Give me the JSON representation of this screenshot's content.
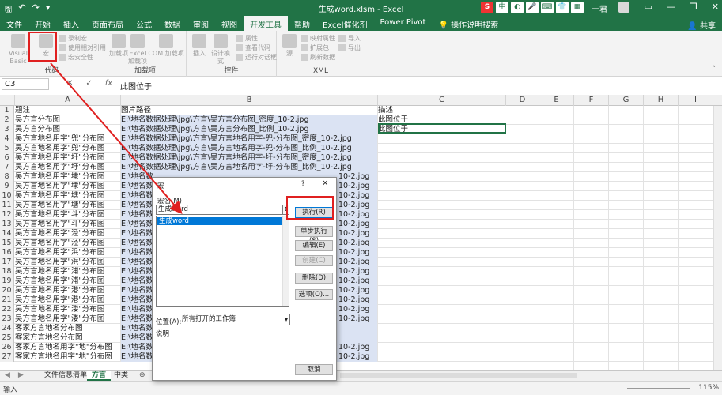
{
  "window": {
    "title": "生成word.xlsm - Excel",
    "user": "一君",
    "brand_letter": "S"
  },
  "ribbon_tabs": [
    {
      "label": "文件",
      "active": false
    },
    {
      "label": "开始",
      "active": false
    },
    {
      "label": "插入",
      "active": false
    },
    {
      "label": "页面布局",
      "active": false
    },
    {
      "label": "公式",
      "active": false
    },
    {
      "label": "数据",
      "active": false
    },
    {
      "label": "审阅",
      "active": false
    },
    {
      "label": "视图",
      "active": false
    },
    {
      "label": "开发工具",
      "active": true
    },
    {
      "label": "帮助",
      "active": false
    },
    {
      "label": "Excel催化剂",
      "active": false
    },
    {
      "label": "Power Pivot",
      "active": false
    },
    {
      "label": "操作说明搜索",
      "active": false
    }
  ],
  "share_label": "共享",
  "ribbon": {
    "code": {
      "label": "代码",
      "visual_basic": "Visual Basic",
      "macro": "宏",
      "record_macro": "录制宏",
      "relative_ref": "使用相对引用",
      "macro_security": "宏安全性"
    },
    "addins": {
      "label": "加载项",
      "addin": "加载项",
      "excel_addin": "Excel 加载项",
      "com_addin": "COM 加载项"
    },
    "controls": {
      "label": "控件",
      "insert": "插入",
      "design_mode": "设计模式",
      "properties": "属性",
      "view_code": "查看代码",
      "run_dialog": "运行对话框"
    },
    "xml": {
      "label": "XML",
      "source": "源",
      "map_props": "映射属性",
      "expansion": "扩展包",
      "refresh": "刷新数据",
      "import": "导入",
      "export": "导出"
    }
  },
  "formula_bar": {
    "name_box": "C3",
    "value": "此图位于"
  },
  "columns": [
    "A",
    "B",
    "C",
    "D",
    "E",
    "F",
    "G",
    "H",
    "I"
  ],
  "rows": [
    {
      "num": "1",
      "a": "题注",
      "b": "图片路径",
      "c": "描述"
    },
    {
      "num": "2",
      "a": "吴方言分布图",
      "b": "E:\\地名数据处理\\jpg\\方言\\吴方言分布图_密度_10-2.jpg",
      "c": "此图位于"
    },
    {
      "num": "3",
      "a": "吴方言分布图",
      "b": "E:\\地名数据处理\\jpg\\方言\\吴方言分布图_比例_10-2.jpg",
      "c": "此图位于"
    },
    {
      "num": "4",
      "a": "吴方言地名用字\"兜\"分布图",
      "b": "E:\\地名数据处理\\jpg\\方言\\吴方言地名用字-兜-分布图_密度_10-2.jpg",
      "c": ""
    },
    {
      "num": "5",
      "a": "吴方言地名用字\"兜\"分布图",
      "b": "E:\\地名数据处理\\jpg\\方言\\吴方言地名用字-兜-分布图_比例_10-2.jpg",
      "c": ""
    },
    {
      "num": "6",
      "a": "吴方言地名用字\"圩\"分布图",
      "b": "E:\\地名数据处理\\jpg\\方言\\吴方言地名用字-圩-分布图_密度_10-2.jpg",
      "c": ""
    },
    {
      "num": "7",
      "a": "吴方言地名用字\"圩\"分布图",
      "b": "E:\\地名数据处理\\jpg\\方言\\吴方言地名用字-圩-分布图_比例_10-2.jpg",
      "c": ""
    },
    {
      "num": "8",
      "a": "吴方言地名用字\"埭\"分布图",
      "b": "E:\\地名数",
      "b_tail": "10-2.jpg",
      "c": ""
    },
    {
      "num": "9",
      "a": "吴方言地名用字\"埭\"分布图",
      "b": "E:\\地名数",
      "b_tail": "10-2.jpg",
      "c": ""
    },
    {
      "num": "10",
      "a": "吴方言地名用字\"塘\"分布图",
      "b": "E:\\地名数",
      "b_tail": "10-2.jpg",
      "c": ""
    },
    {
      "num": "11",
      "a": "吴方言地名用字\"塘\"分布图",
      "b": "E:\\地名数",
      "b_tail": "10-2.jpg",
      "c": ""
    },
    {
      "num": "12",
      "a": "吴方言地名用字\"斗\"分布图",
      "b": "E:\\地名数",
      "b_tail": "10-2.jpg",
      "c": ""
    },
    {
      "num": "13",
      "a": "吴方言地名用字\"斗\"分布图",
      "b": "E:\\地名数",
      "b_tail": "10-2.jpg",
      "c": ""
    },
    {
      "num": "14",
      "a": "吴方言地名用字\"泾\"分布图",
      "b": "E:\\地名数",
      "b_tail": "10-2.jpg",
      "c": ""
    },
    {
      "num": "15",
      "a": "吴方言地名用字\"泾\"分布图",
      "b": "E:\\地名数",
      "b_tail": "10-2.jpg",
      "c": ""
    },
    {
      "num": "16",
      "a": "吴方言地名用字\"浜\"分布图",
      "b": "E:\\地名数",
      "b_tail": "10-2.jpg",
      "c": ""
    },
    {
      "num": "17",
      "a": "吴方言地名用字\"浜\"分布图",
      "b": "E:\\地名数",
      "b_tail": "10-2.jpg",
      "c": ""
    },
    {
      "num": "18",
      "a": "吴方言地名用字\"浦\"分布图",
      "b": "E:\\地名数",
      "b_tail": "10-2.jpg",
      "c": ""
    },
    {
      "num": "19",
      "a": "吴方言地名用字\"浦\"分布图",
      "b": "E:\\地名数",
      "b_tail": "10-2.jpg",
      "c": ""
    },
    {
      "num": "20",
      "a": "吴方言地名用字\"港\"分布图",
      "b": "E:\\地名数",
      "b_tail": "10-2.jpg",
      "c": ""
    },
    {
      "num": "21",
      "a": "吴方言地名用字\"港\"分布图",
      "b": "E:\\地名数",
      "b_tail": "10-2.jpg",
      "c": ""
    },
    {
      "num": "22",
      "a": "吴方言地名用字\"溇\"分布图",
      "b": "E:\\地名数",
      "b_tail": "10-2.jpg",
      "c": ""
    },
    {
      "num": "23",
      "a": "吴方言地名用字\"溇\"分布图",
      "b": "E:\\地名数",
      "b_tail": "10-2.jpg",
      "c": ""
    },
    {
      "num": "24",
      "a": "客家方言地名分布图",
      "b": "E:\\地名数",
      "b_tail": "",
      "c": ""
    },
    {
      "num": "25",
      "a": "客家方言地名分布图",
      "b": "E:\\地名数",
      "b_tail": "",
      "c": ""
    },
    {
      "num": "26",
      "a": "客家方言地名用字\"地\"分布图",
      "b": "E:\\地名数",
      "b_tail": "10-2.jpg",
      "c": ""
    },
    {
      "num": "27",
      "a": "客家方言地名用字\"地\"分布图",
      "b": "E:\\地名数",
      "b_tail": "10-2.jpg",
      "c": ""
    }
  ],
  "sheet_tabs": [
    {
      "label": "文件信息清单",
      "active": false
    },
    {
      "label": "方言",
      "active": true
    },
    {
      "label": "中类",
      "active": false
    }
  ],
  "status": {
    "mode": "输入",
    "zoom": "115%"
  },
  "dialog": {
    "title": "宏",
    "help": "?",
    "close": "✕",
    "name_label": "宏名(M):",
    "name_value": "生成word",
    "list_items": [
      "生成word"
    ],
    "buttons": {
      "run": "执行(R)",
      "step": "单步执行(S)",
      "edit": "编辑(E)",
      "create": "创建(C)",
      "delete": "删除(D)",
      "options": "选项(O)..."
    },
    "location_label": "位置(A):",
    "location_value": "所有打开的工作簿",
    "description_label": "说明",
    "cancel": "取消"
  },
  "colors": {
    "excel_green": "#217346",
    "annotation_red": "#e02020",
    "selection_blue": "#0078d7"
  }
}
